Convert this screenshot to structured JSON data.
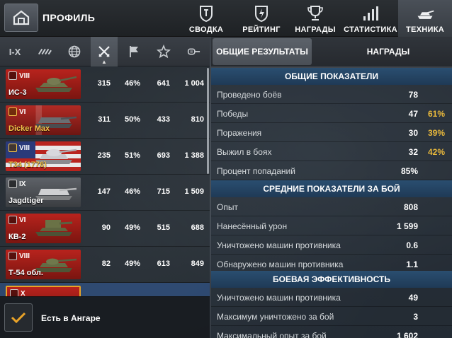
{
  "header": {
    "title": "ПРОФИЛЬ",
    "tabs": [
      {
        "label": "СВОДКА",
        "icon": "shield-icon"
      },
      {
        "label": "РЕЙТИНГ",
        "icon": "rating-shield-icon"
      },
      {
        "label": "НАГРАДЫ",
        "icon": "trophy-icon"
      },
      {
        "label": "СТАТИСТИКА",
        "icon": "bar-chart-icon"
      },
      {
        "label": "ТЕХНИКА",
        "icon": "tank-icon"
      }
    ],
    "active_tab": "ТЕХНИКА"
  },
  "filters": {
    "tier_label": "I-X",
    "items": [
      "tier-filter",
      "vehicle-class-filter",
      "nation-globe-icon",
      "crossed-swords-icon",
      "flag-icon",
      "star-icon",
      "module-icon"
    ],
    "active": "crossed-swords-icon"
  },
  "stats_tabs": {
    "general": "ОБЩИЕ РЕЗУЛЬТАТЫ",
    "awards": "НАГРАДЫ"
  },
  "vehicles": [
    {
      "tier": "VIII",
      "name": "ИС-3",
      "nation": "ussr",
      "premium": false,
      "battles": "315",
      "winrate": "46%",
      "avg_damage": "641",
      "avg_xp": "1 004"
    },
    {
      "tier": "VI",
      "name": "Dicker Max",
      "nation": "de",
      "premium": true,
      "battles": "311",
      "winrate": "50%",
      "avg_damage": "433",
      "avg_xp": "810"
    },
    {
      "tier": "VIII",
      "name": "T34 (1776)",
      "nation": "us",
      "premium": true,
      "battles": "235",
      "winrate": "51%",
      "avg_damage": "693",
      "avg_xp": "1 388"
    },
    {
      "tier": "IX",
      "name": "Jagdtiger",
      "nation": "de",
      "premium": false,
      "battles": "147",
      "winrate": "46%",
      "avg_damage": "715",
      "avg_xp": "1 509"
    },
    {
      "tier": "VI",
      "name": "КВ-2",
      "nation": "ussr",
      "premium": false,
      "battles": "90",
      "winrate": "49%",
      "avg_damage": "515",
      "avg_xp": "688"
    },
    {
      "tier": "VIII",
      "name": "Т-54 обл.",
      "nation": "ussr",
      "premium": false,
      "battles": "82",
      "winrate": "49%",
      "avg_damage": "613",
      "avg_xp": "849"
    },
    {
      "tier": "X",
      "name": "",
      "nation": "ussr",
      "premium": false,
      "battles": "",
      "winrate": "",
      "avg_damage": "",
      "avg_xp": ""
    }
  ],
  "hangar_filter": {
    "label": "Есть в Ангаре",
    "checked": true
  },
  "sections": [
    {
      "title": "ОБЩИЕ ПОКАЗАТЕЛИ",
      "rows": [
        {
          "label": "Проведено боёв",
          "value": "78",
          "percent": ""
        },
        {
          "label": "Победы",
          "value": "47",
          "percent": "61%"
        },
        {
          "label": "Поражения",
          "value": "30",
          "percent": "39%"
        },
        {
          "label": "Выжил в боях",
          "value": "32",
          "percent": "42%"
        },
        {
          "label": "Процент попаданий",
          "value": "85%",
          "percent": ""
        }
      ]
    },
    {
      "title": "СРЕДНИЕ ПОКАЗАТЕЛИ ЗА БОЙ",
      "rows": [
        {
          "label": "Опыт",
          "value": "808",
          "percent": ""
        },
        {
          "label": "Нанесённый урон",
          "value": "1 599",
          "percent": ""
        },
        {
          "label": "Уничтожено машин противника",
          "value": "0.6",
          "percent": ""
        },
        {
          "label": "Обнаружено машин противника",
          "value": "1.1",
          "percent": ""
        }
      ]
    },
    {
      "title": "БОЕВАЯ ЭФФЕКТИВНОСТЬ",
      "rows": [
        {
          "label": "Уничтожено машин противника",
          "value": "49",
          "percent": ""
        },
        {
          "label": "Максимум уничтожено за бой",
          "value": "3",
          "percent": ""
        },
        {
          "label": "Максимальный опыт за бой",
          "value": "1 602",
          "percent": ""
        }
      ]
    }
  ],
  "colors": {
    "accent_gold": "#e9b93c",
    "premium_name": "#f3c24b",
    "section_header": "#2a4e70",
    "selected_border": "#e8a326"
  }
}
